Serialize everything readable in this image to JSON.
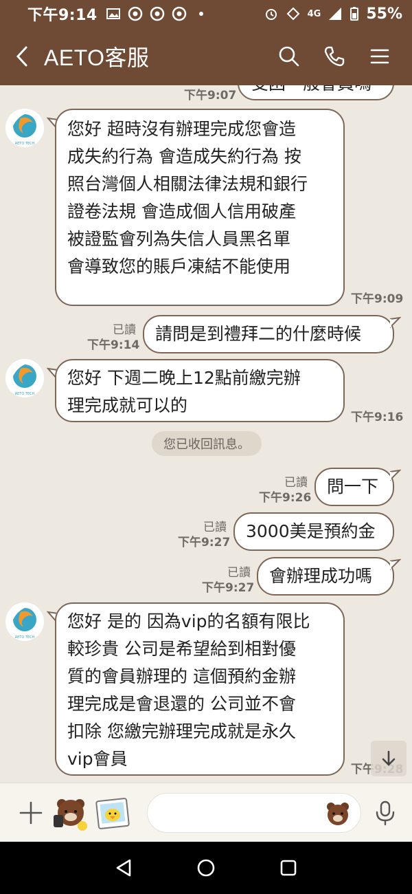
{
  "status_bar": {
    "time": "下午9:14",
    "network": "4G",
    "battery": "55%"
  },
  "header": {
    "title": "AETO客服"
  },
  "messages": [
    {
      "id": "m0",
      "direction": "out",
      "partial": true,
      "text": "受困一般會員嗎",
      "time": "下午9:07"
    },
    {
      "id": "m1",
      "direction": "in",
      "text": "您好 超時沒有辦理完成您會造\n成失約行為 會造成失約行為 按\n照台灣個人相關法律法規和銀行\n證卷法規 會造成個人信用破產\n被證監會列為失信人員黑名單\n會導致您的賬戶凍結不能使用",
      "time": "下午9:09"
    },
    {
      "id": "m2",
      "direction": "out",
      "text": "請問是到禮拜二的什麼時候",
      "read": "已讀",
      "time": "下午9:14"
    },
    {
      "id": "m3",
      "direction": "in",
      "text": "您好 下週二晚上12點前繳完辦\n理完成就可以的",
      "time": "下午9:16"
    },
    {
      "id": "m4",
      "direction": "out",
      "text": "問一下",
      "read": "已讀",
      "time": "下午9:26"
    },
    {
      "id": "m5",
      "direction": "out",
      "text": "3000美是預約金",
      "read": "已讀",
      "time": "下午9:27"
    },
    {
      "id": "m6",
      "direction": "out",
      "text": "會辦理成功嗎",
      "read": "已讀",
      "time": "下午9:27"
    },
    {
      "id": "m7",
      "direction": "in",
      "text": "您好 是的  因為vip的名額有限比\n較珍貴 公司是希望給到相對優\n質的會員辦理的 這個預約金辦\n理完成是會退還的 公司並不會\n扣除 您繳完辦理完成就是永久\nvip會員",
      "time": "下午9:28"
    }
  ],
  "system_notice": "您已收回訊息。",
  "avatar_brand": "AETO TECH",
  "input": {
    "value": "",
    "placeholder": ""
  },
  "colors": {
    "header_bg": "#6f4a35",
    "chat_bg": "#ede8e0",
    "bubble_border": "#7c6657",
    "timestamp": "#6f6a64"
  },
  "icons": {
    "back": "chevron-left-icon",
    "search": "search-icon",
    "call": "phone-icon",
    "menu": "menu-icon",
    "add": "plus-icon",
    "emoji": "bear-emoji-icon",
    "mic": "microphone-icon",
    "scroll": "arrow-down-icon"
  }
}
